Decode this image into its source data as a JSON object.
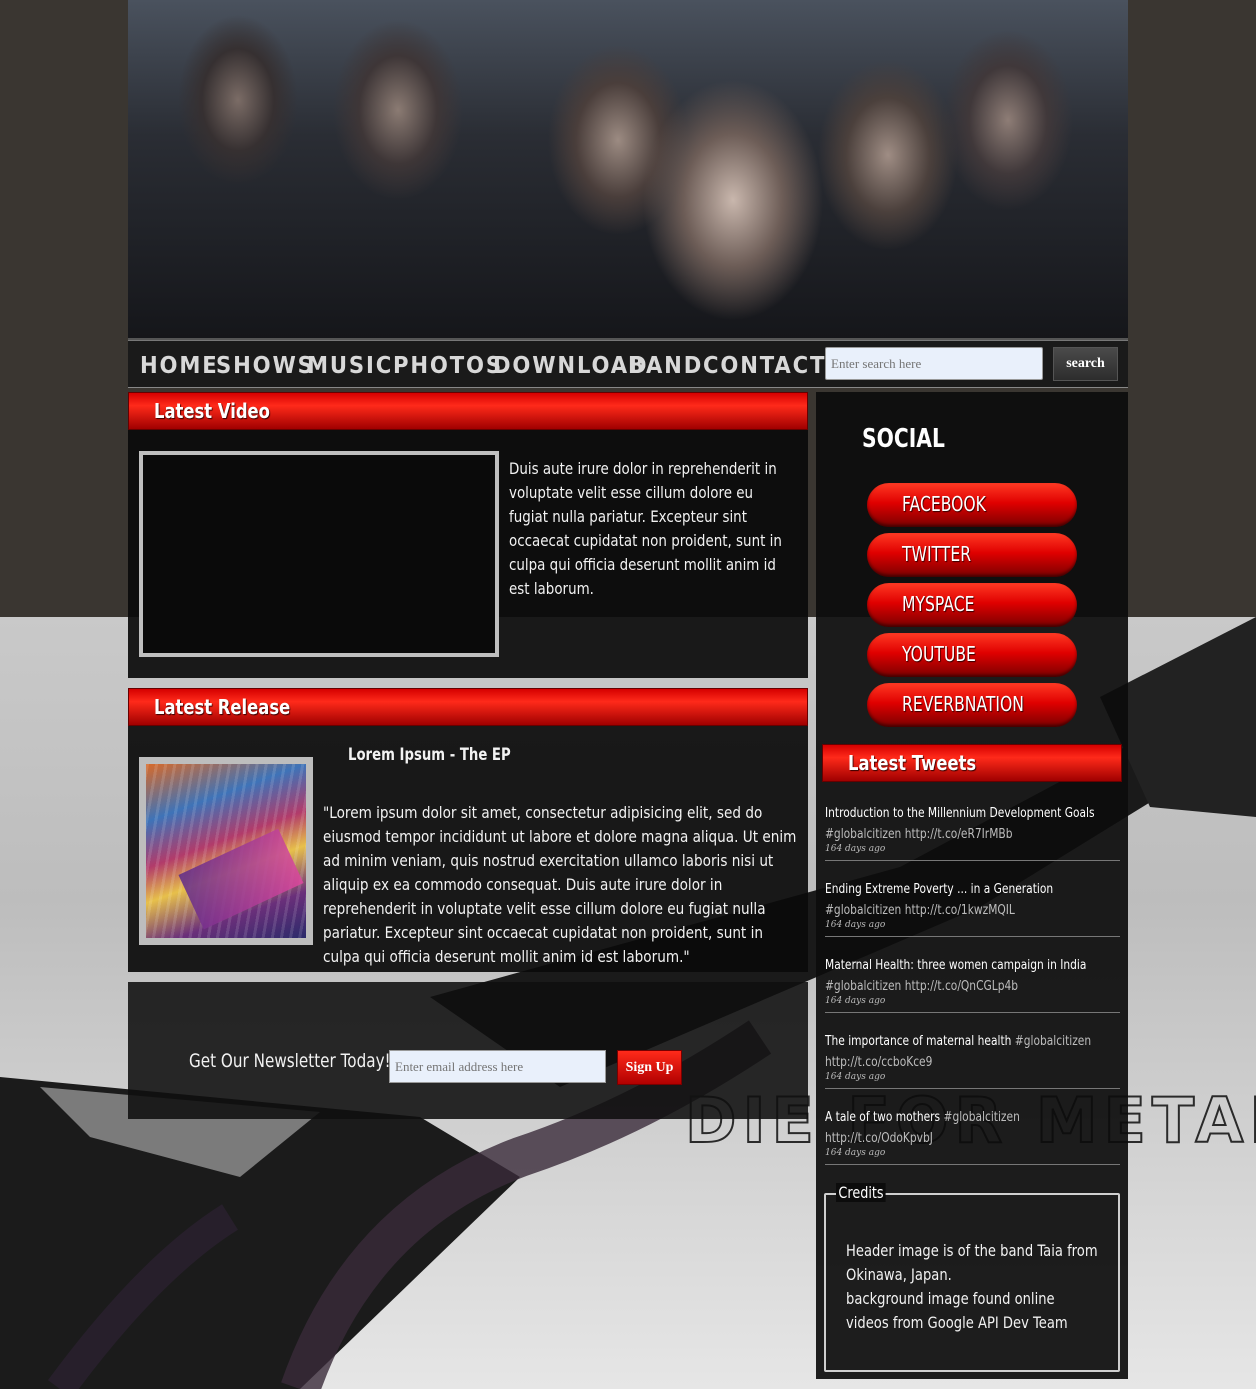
{
  "nav": {
    "items": [
      "HOME",
      "SHOWS",
      "MUSIC",
      "PHOTOS",
      "DOWNLOAD",
      "BAND",
      "CONTACT"
    ]
  },
  "search": {
    "placeholder": "Enter search here",
    "button": "search"
  },
  "latest_video": {
    "title": "Latest Video",
    "text": "Duis aute irure dolor in reprehenderit in voluptate velit esse cillum dolore eu fugiat nulla pariatur. Excepteur sint occaecat cupidatat non proident, sunt in culpa qui officia deserunt mollit anim id est laborum."
  },
  "latest_release": {
    "title": "Latest Release",
    "album_title": "Lorem Ipsum - The EP",
    "text": "\"Lorem ipsum dolor sit amet, consectetur adipisicing elit, sed do eiusmod tempor incididunt ut labore et dolore magna aliqua. Ut enim ad minim veniam, quis nostrud exercitation ullamco laboris nisi ut aliquip ex ea commodo consequat. Duis aute irure dolor in reprehenderit in voluptate velit esse cillum dolore eu fugiat nulla pariatur. Excepteur sint occaecat cupidatat non proident, sunt in culpa qui officia deserunt mollit anim id est laborum.\""
  },
  "newsletter": {
    "label": "Get Our Newsletter Today!",
    "placeholder": "Enter email address here",
    "button": "Sign Up"
  },
  "social": {
    "title": "SOCIAL",
    "links": [
      "FACEBOOK",
      "TWITTER",
      "MYSPACE",
      "YOUTUBE",
      "REVERBNATION"
    ]
  },
  "tweets": {
    "title": "Latest Tweets",
    "items": [
      {
        "text": "Introduction to the Millennium Development Goals",
        "tag": "#globalcitizen",
        "link": "http://t.co/eR7IrMBb",
        "time": "164 days ago"
      },
      {
        "text": "Ending Extreme Poverty ... in a Generation",
        "tag": "#globalcitizen",
        "link": "http://t.co/1kwzMQIL",
        "time": "164 days ago"
      },
      {
        "text": "Maternal Health: three women campaign in India",
        "tag": "#globalcitizen",
        "link": "http://t.co/QnCGLp4b",
        "time": "164 days ago"
      },
      {
        "text": "The importance of maternal health",
        "tag": "#globalcitizen",
        "link": "http://t.co/ccboKce9",
        "time": "164 days ago"
      },
      {
        "text": "A tale of two mothers",
        "tag": "#globalcitizen",
        "link": "http://t.co/OdoKpvbJ",
        "time": "164 days ago"
      }
    ]
  },
  "credits": {
    "legend": "Credits",
    "lines": [
      "Header image is of the band Taia from",
      "Okinawa, Japan.",
      "background image found online",
      "videos from Google API Dev Team"
    ]
  },
  "background_logo_text": "DIE FOR METAL",
  "colors": {
    "accent_red": "#e00000",
    "panel": "#0c0c0c",
    "top_band": "#3a3631"
  }
}
